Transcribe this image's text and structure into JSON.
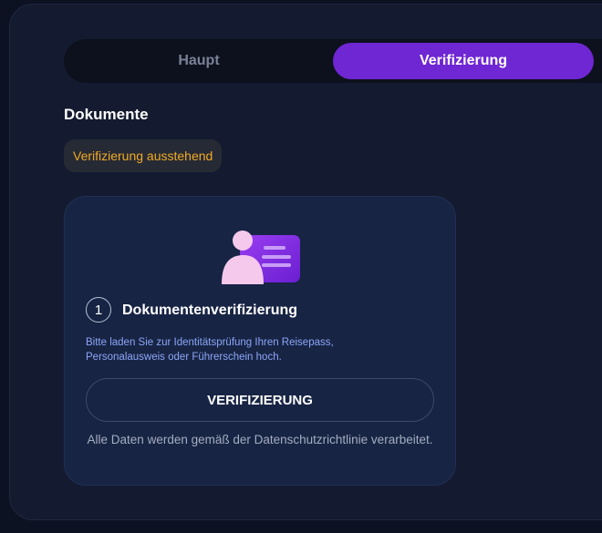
{
  "tabs": [
    {
      "label": "Haupt",
      "active": false
    },
    {
      "label": "Verifizierung",
      "active": true
    }
  ],
  "documents": {
    "title": "Dokumente",
    "status": "Verifizierung ausstehend",
    "status_color": "#f2aa26"
  },
  "step": {
    "number": "1",
    "title": "Dokumentenverifizierung",
    "description": "Bitte laden Sie zur Identitätsprüfung Ihren Reisepass, Personalausweis oder Führerschein hoch.",
    "button_label": "VERIFIZIERUNG",
    "note": "Alle Daten werden gemäß der Datenschutzrichtlinie verarbeitet.",
    "icon": "id-card-icon"
  },
  "colors": {
    "accent": "#6f26d3",
    "background": "#0d1222",
    "panel": "#141b30",
    "card": "#172444",
    "description_text": "#8da6f7"
  }
}
